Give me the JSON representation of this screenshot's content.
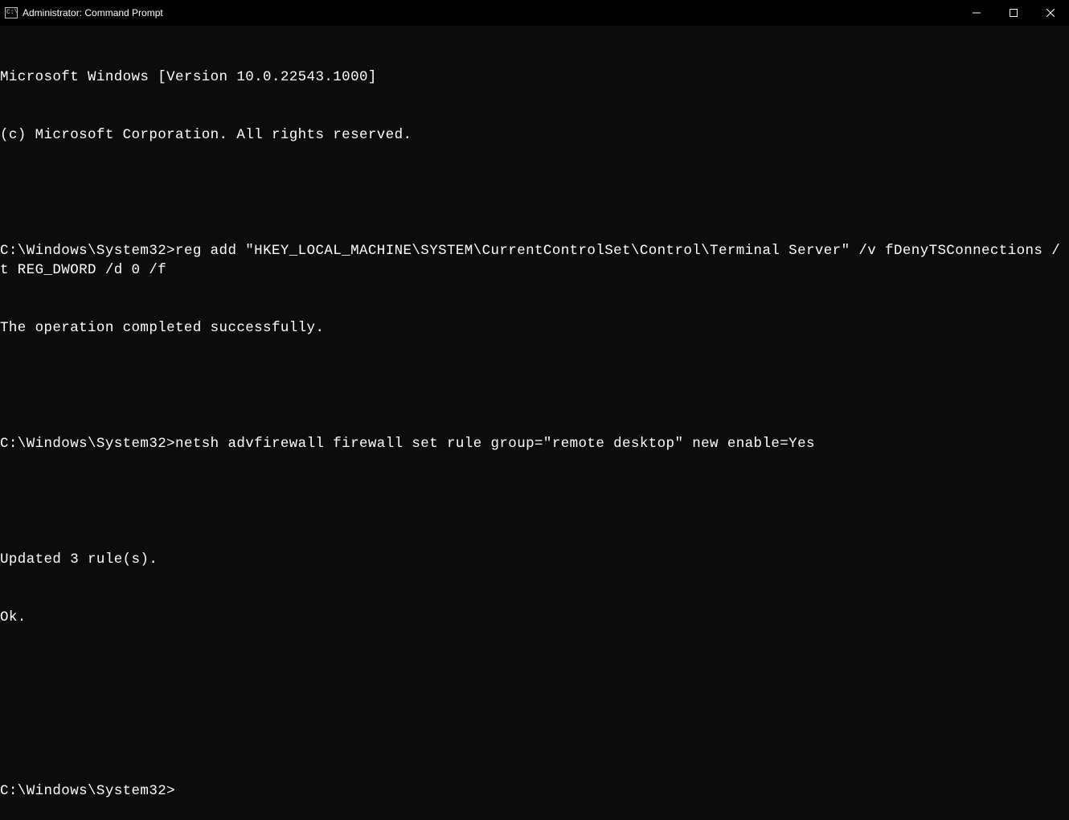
{
  "window": {
    "title": "Administrator: Command Prompt",
    "icon_text": "C:\\"
  },
  "terminal": {
    "banner1": "Microsoft Windows [Version 10.0.22543.1000]",
    "banner2": "(c) Microsoft Corporation. All rights reserved.",
    "prompt1": "C:\\Windows\\System32>",
    "cmd1": "reg add \"HKEY_LOCAL_MACHINE\\SYSTEM\\CurrentControlSet\\Control\\Terminal Server\" /v fDenyTSConnections /t REG_DWORD /d 0 /f",
    "out1": "The operation completed successfully.",
    "prompt2": "C:\\Windows\\System32>",
    "cmd2": "netsh advfirewall firewall set rule group=\"remote desktop\" new enable=Yes",
    "out2a": "Updated 3 rule(s).",
    "out2b": "Ok.",
    "prompt3": "C:\\Windows\\System32>"
  }
}
